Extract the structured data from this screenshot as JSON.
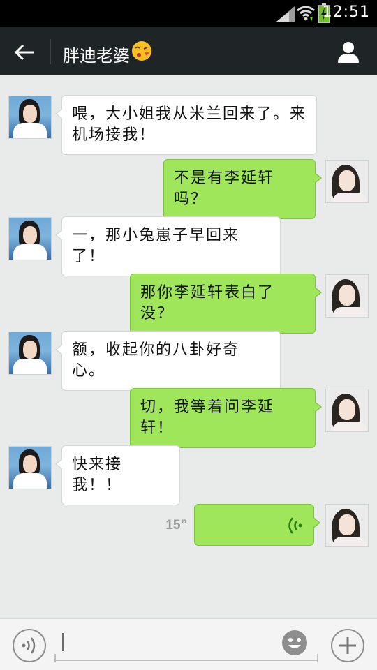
{
  "status_bar": {
    "time": "12:51"
  },
  "header": {
    "title": "胖迪老婆"
  },
  "messages": [
    {
      "side": "left",
      "text": "喂，大小姐我从米兰回来了。来机场接我！"
    },
    {
      "side": "right",
      "text": "不是有李延轩吗？"
    },
    {
      "side": "left",
      "text": "一，那小兔崽子早回来了！"
    },
    {
      "side": "right",
      "text": "那你李延轩表白了没？"
    },
    {
      "side": "left",
      "text": "额，收起你的八卦好奇心。"
    },
    {
      "side": "right",
      "text": "切，我等着问李延轩！"
    },
    {
      "side": "left",
      "text": "快来接我！！"
    },
    {
      "side": "right",
      "type": "voice",
      "duration": "15”"
    }
  ],
  "input": {
    "placeholder": ""
  },
  "colors": {
    "sent_bubble": "#9fe65a",
    "received_bubble": "#ffffff",
    "header_bg": "#1f2526",
    "chat_bg": "#e9eaea"
  }
}
